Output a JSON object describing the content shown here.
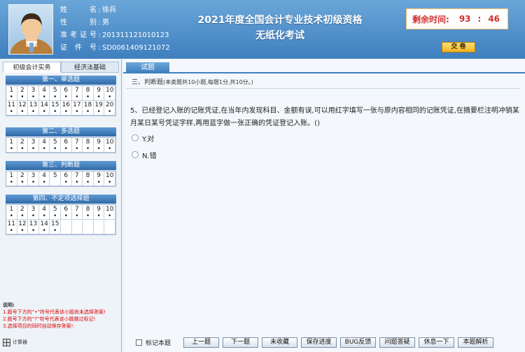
{
  "candidate": {
    "rows": [
      {
        "label": "姓名",
        "value": "徐兵"
      },
      {
        "label": "性别",
        "value": "男"
      },
      {
        "label": "准考证号",
        "value": "201311121010123"
      },
      {
        "label": "证件号",
        "value": "SD0061409121072"
      }
    ],
    "sep": ":"
  },
  "exam": {
    "title_line1": "2021年度全国会计专业技术初级资格",
    "title_line2": "无纸化考试"
  },
  "timer": {
    "label": "剩余时间:",
    "minutes": "93",
    "colon": ":",
    "seconds": "46"
  },
  "submit_label": "交 卷",
  "subject_tabs": [
    {
      "label": "初级会计实务",
      "active": true
    },
    {
      "label": "经济法基础",
      "active": false
    }
  ],
  "blocks": [
    {
      "title": "第一、单选题",
      "cells": [
        {
          "n": "1",
          "m": "•"
        },
        {
          "n": "2",
          "m": "•"
        },
        {
          "n": "3",
          "m": "•"
        },
        {
          "n": "4",
          "m": "•"
        },
        {
          "n": "5",
          "m": "•"
        },
        {
          "n": "6",
          "m": "•"
        },
        {
          "n": "7",
          "m": "•"
        },
        {
          "n": "8",
          "m": "•"
        },
        {
          "n": "9",
          "m": "•"
        },
        {
          "n": "10",
          "m": "•"
        },
        {
          "n": "11",
          "m": "•"
        },
        {
          "n": "12",
          "m": "•"
        },
        {
          "n": "13",
          "m": "•"
        },
        {
          "n": "14",
          "m": "•"
        },
        {
          "n": "15",
          "m": "•"
        },
        {
          "n": "16",
          "m": "•"
        },
        {
          "n": "17",
          "m": "•"
        },
        {
          "n": "18",
          "m": "•"
        },
        {
          "n": "19",
          "m": "•"
        },
        {
          "n": "20",
          "m": "•"
        }
      ]
    },
    {
      "title": "第二、多选题",
      "cells": [
        {
          "n": "1",
          "m": "•"
        },
        {
          "n": "2",
          "m": "•"
        },
        {
          "n": "3",
          "m": "•"
        },
        {
          "n": "4",
          "m": "•"
        },
        {
          "n": "5",
          "m": "•"
        },
        {
          "n": "6",
          "m": "•"
        },
        {
          "n": "7",
          "m": "•"
        },
        {
          "n": "8",
          "m": "•"
        },
        {
          "n": "9",
          "m": "•"
        },
        {
          "n": "10",
          "m": "•"
        }
      ]
    },
    {
      "title": "第三、判断题",
      "cells": [
        {
          "n": "1",
          "m": "•"
        },
        {
          "n": "2",
          "m": "•"
        },
        {
          "n": "3",
          "m": "•"
        },
        {
          "n": "4",
          "m": "•"
        },
        {
          "n": "5",
          "m": ""
        },
        {
          "n": "6",
          "m": "•"
        },
        {
          "n": "7",
          "m": "•"
        },
        {
          "n": "8",
          "m": "•"
        },
        {
          "n": "9",
          "m": "•"
        },
        {
          "n": "10",
          "m": "•"
        }
      ]
    },
    {
      "title": "第四、不定项选择题",
      "cells": [
        {
          "n": "1",
          "m": "•"
        },
        {
          "n": "2",
          "m": "•"
        },
        {
          "n": "3",
          "m": "•"
        },
        {
          "n": "4",
          "m": "•"
        },
        {
          "n": "5",
          "m": "•"
        },
        {
          "n": "6",
          "m": "•"
        },
        {
          "n": "7",
          "m": "•"
        },
        {
          "n": "8",
          "m": "•"
        },
        {
          "n": "9",
          "m": "•"
        },
        {
          "n": "10",
          "m": "•"
        },
        {
          "n": "11",
          "m": "•"
        },
        {
          "n": "12",
          "m": "•"
        },
        {
          "n": "13",
          "m": "•"
        },
        {
          "n": "14",
          "m": "•"
        },
        {
          "n": "15",
          "m": "•"
        }
      ]
    }
  ],
  "notes": {
    "head": "说明:",
    "lines": [
      "1.题号下方的“•”符号代表该小题尚未选择答案!",
      "2.题号下方的“?”符号代表该小题做过标记!",
      "3.选择项目的同时自动保存答案!"
    ]
  },
  "calculator_label": "计算器",
  "main_tab": "试题",
  "section": {
    "title": "三、判断题",
    "detail": "(本类题共10小题,每题1分,共10分。)"
  },
  "question": "5、已经登记入账的记账凭证,在当年内发现科目、金额有误,可以用红字填写一张与原内容相同的记账凭证,在摘要栏注明冲销某月某日某号凭证字样,再用蓝字做一张正确的凭证登记入账。()",
  "options": [
    {
      "label": "Y.对"
    },
    {
      "label": "N.错"
    }
  ],
  "bottom": {
    "mark_label": "标记本题",
    "buttons": [
      "上一题",
      "下一题",
      "未收藏",
      "保存进度",
      "BUG反馈",
      "问题答疑",
      "休息一下",
      "本题解析"
    ]
  }
}
